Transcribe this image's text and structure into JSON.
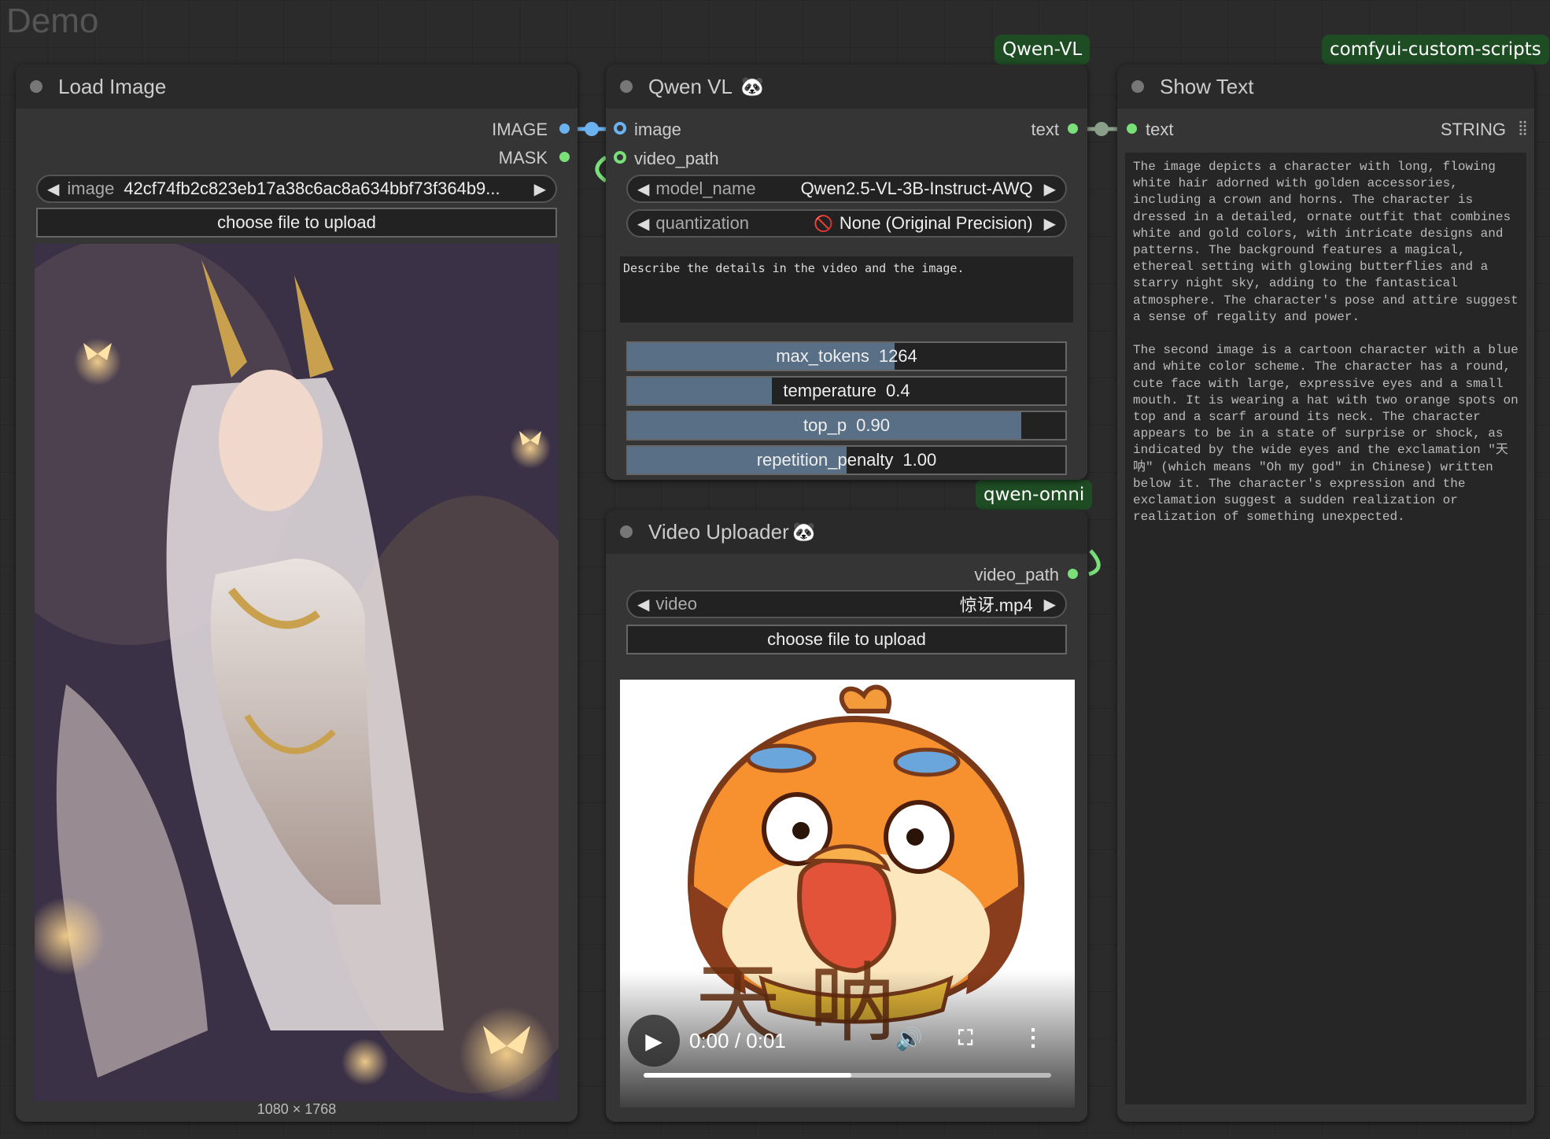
{
  "group": {
    "title": "Demo"
  },
  "badges": {
    "qwen_vl": "Qwen-VL",
    "custom_scripts": "comfyui-custom-scripts",
    "qwen_omni": "qwen-omni"
  },
  "load_image": {
    "title": "Load Image",
    "outputs": [
      "IMAGE",
      "MASK"
    ],
    "image_widget": {
      "label": "image",
      "value": "42cf74fb2c823eb17a38c6ac8a634bbf73f364b9..."
    },
    "upload_label": "choose file to upload",
    "dimensions": "1080 × 1768"
  },
  "qwen_vl": {
    "title": "Qwen VL",
    "inputs": [
      "image",
      "video_path"
    ],
    "output": "text",
    "model_name": {
      "label": "model_name",
      "value": "Qwen2.5-VL-3B-Instruct-AWQ"
    },
    "quantization": {
      "label": "quantization",
      "value": "None (Original Precision)"
    },
    "prompt": "Describe the details in the video and the image.",
    "sliders": [
      {
        "label": "max_tokens",
        "value": "1264",
        "fraction": 0.61
      },
      {
        "label": "temperature",
        "value": "0.4",
        "fraction": 0.33
      },
      {
        "label": "top_p",
        "value": "0.90",
        "fraction": 0.9
      },
      {
        "label": "repetition_penalty",
        "value": "1.00",
        "fraction": 0.5
      }
    ]
  },
  "show_text": {
    "title": "Show Text",
    "input": "text",
    "output": "STRING",
    "content": "The image depicts a character with long, flowing\nwhite hair adorned with golden accessories,\nincluding a crown and horns. The character is\ndressed in a detailed, ornate outfit that combines\nwhite and gold colors, with intricate designs and\npatterns. The background features a magical,\nethereal setting with glowing butterflies and a\nstarry night sky, adding to the fantastical\natmosphere. The character's pose and attire suggest\na sense of regality and power.\n\nThe second image is a cartoon character with a blue\nand white color scheme. The character has a round,\ncute face with large, expressive eyes and a small\nmouth. It is wearing a hat with two orange spots on\ntop and a scarf around its neck. The character\nappears to be in a state of surprise or shock, as\nindicated by the wide eyes and the exclamation \"天\n呐\" (which means \"Oh my god\" in Chinese) written\nbelow it. The character's expression and the\nexclamation suggest a sudden realization or\nrealization of something unexpected."
  },
  "video_uploader": {
    "title": "Video Uploader",
    "output": "video_path",
    "video_widget": {
      "label": "video",
      "value": "惊讶.mp4"
    },
    "upload_label": "choose file to upload",
    "player": {
      "time": "0:00 / 0:01",
      "progress": 0.51,
      "overlay_text": "天 呐"
    }
  },
  "icons": {
    "play": "play-icon",
    "volume": "volume-icon",
    "fullscreen": "fullscreen-icon",
    "more": "more-vertical-icon",
    "panda": "panda-icon",
    "grid": "grid-icon"
  }
}
